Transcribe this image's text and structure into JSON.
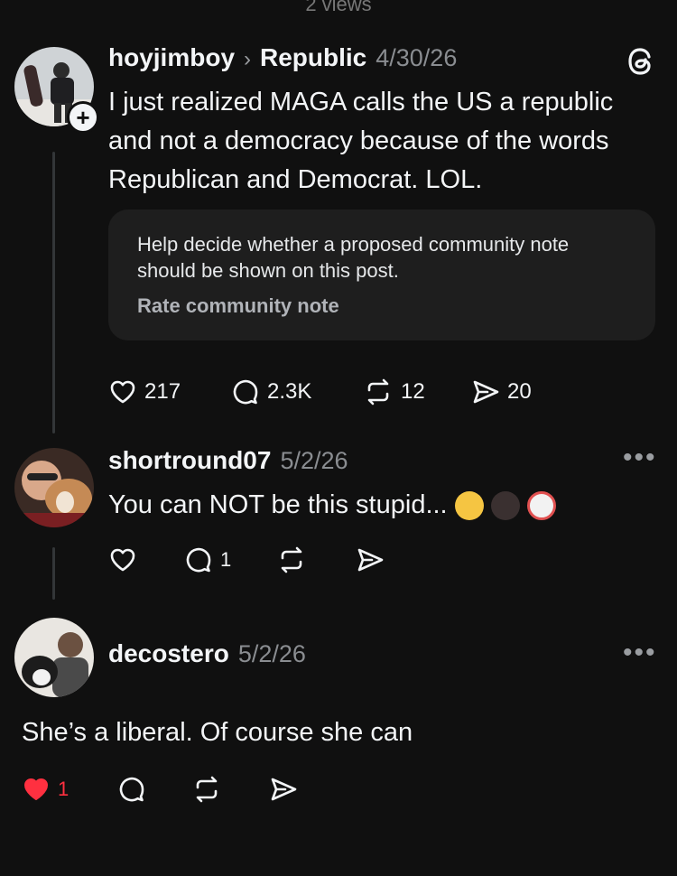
{
  "top_partial": "2 views",
  "post": {
    "username": "hoyjimboy",
    "community": "Republic",
    "date": "4/30/26",
    "text_line1": "I just realized MAGA calls the US a republic",
    "text_line2": "and not a democracy because of the words",
    "text_line3": "Republican and Democrat. LOL.",
    "note_line1": "Help decide whether a proposed community note",
    "note_line2": "should be shown on this post.",
    "note_link": "Rate community note",
    "likes": "217",
    "replies": "2.3K",
    "reposts": "12",
    "shares": "20"
  },
  "reply1": {
    "username": "shortround07",
    "date": "5/2/26",
    "text": "You can NOT be this stupid...",
    "reply_count": "1"
  },
  "reply2": {
    "username": "decostero",
    "date": "5/2/26",
    "text": "She’s a liberal. Of course she can",
    "like_count": "1"
  },
  "colors": {
    "background": "#101010",
    "card": "#1e1e1e",
    "muted": "#8a8d91",
    "like_red": "#ff3040"
  }
}
